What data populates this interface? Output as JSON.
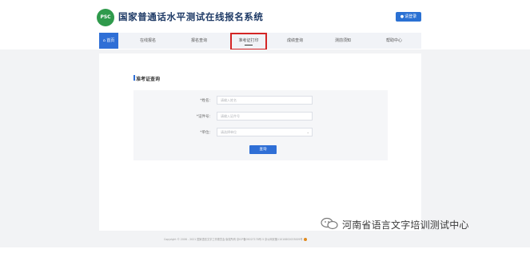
{
  "header": {
    "logo_text": "PSC",
    "title": "国家普通话水平测试在线报名系统",
    "login_icon": "user-icon",
    "login_label": "请登录"
  },
  "nav": {
    "items": [
      {
        "label": "首页",
        "icon": "home-icon"
      },
      {
        "label": "在线报名"
      },
      {
        "label": "报名查询"
      },
      {
        "label": "准考证打印"
      },
      {
        "label": "成绩查询"
      },
      {
        "label": "测前须知"
      },
      {
        "label": "帮助中心"
      }
    ],
    "active_index": 0,
    "highlighted_index": 3,
    "highlight_color": "#d42525",
    "accent_color": "#2f6fd6"
  },
  "section": {
    "title": "准考证查询"
  },
  "form": {
    "name_label": "*姓名：",
    "name_placeholder": "请输入姓名",
    "id_label": "*证件号：",
    "id_placeholder": "请输入证件号",
    "org_label": "*单位：",
    "org_placeholder": "请选择单位",
    "query_label": "查询"
  },
  "footer": {
    "text": "Copyright © 2006 - 2021 国家语言文字工作委员会 版权所有 京ICP备05027178号-5 京公网安备11010802033009号"
  },
  "watermark": {
    "icon": "wechat-icon",
    "text": "河南省语言文字培训测试中心"
  }
}
